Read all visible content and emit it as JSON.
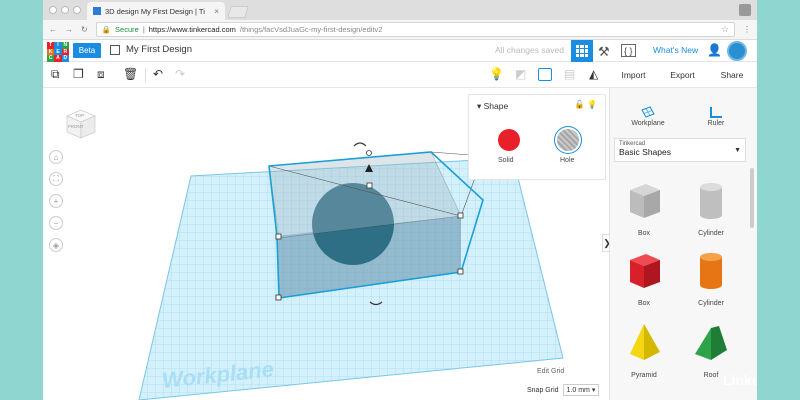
{
  "browser": {
    "tab_title": "3D design My First Design | Ti",
    "tab_close": "×",
    "secure_label": "Secure",
    "url_host": "https://www.tinkercad.com",
    "url_path": "/things/facVsdJuaGc-my-first-design/editv2"
  },
  "header": {
    "logo_letters": [
      "T",
      "I",
      "N",
      "K",
      "E",
      "R",
      "C",
      "A",
      "D"
    ],
    "beta_label": "Beta",
    "design_title": "My First Design",
    "save_status": "All changes saved",
    "code_label": "{ }",
    "whats_new": "What's New"
  },
  "toolbar": {
    "import_label": "Import",
    "export_label": "Export",
    "share_label": "Share"
  },
  "view_cube": {
    "top_label": "TOP",
    "front_label": "FRONT"
  },
  "inspector": {
    "heading": "Shape",
    "solid_label": "Solid",
    "hole_label": "Hole",
    "solid_color": "#e8202a"
  },
  "panel": {
    "workplane_tool": "Workplane",
    "ruler_tool": "Ruler",
    "library_source": "Tinkercad",
    "library_name": "Basic Shapes",
    "shapes": [
      {
        "name": "Box",
        "style": "hole"
      },
      {
        "name": "Cylinder",
        "style": "hole"
      },
      {
        "name": "Box",
        "style": "solid",
        "color": "#d8202a"
      },
      {
        "name": "Cylinder",
        "style": "solid",
        "color": "#e87514"
      },
      {
        "name": "Pyramid",
        "style": "solid",
        "color": "#f3d712"
      },
      {
        "name": "Roof",
        "style": "solid",
        "color": "#2fa34a"
      }
    ]
  },
  "viewport": {
    "workplane_text": "Workplane",
    "edit_grid": "Edit Grid",
    "snap_grid_label": "Snap Grid",
    "snap_grid_value": "1.0 mm ▾"
  },
  "watermark": {
    "linked": "Linked",
    "in": "in"
  }
}
